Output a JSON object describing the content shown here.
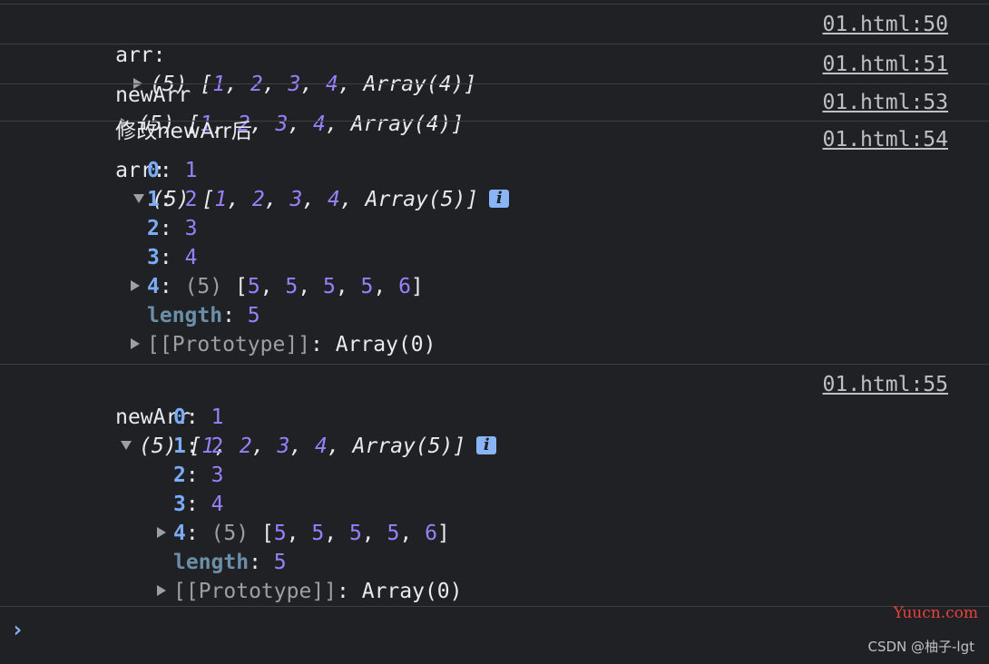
{
  "messages": [
    {
      "source": "01.html:50",
      "label": "arr:",
      "summary": {
        "count": "(5)",
        "open": "[",
        "v1": "1",
        "v2": "2",
        "v3": "3",
        "v4": "4",
        "tail": "Array(4)",
        "close": "]"
      }
    },
    {
      "source": "01.html:51",
      "label": "newArr",
      "summary": {
        "count": "(5)",
        "open": "[",
        "v1": "1",
        "v2": "2",
        "v3": "3",
        "v4": "4",
        "tail": "Array(4)",
        "close": "]"
      }
    },
    {
      "source": "01.html:53",
      "label": "修改newArr后"
    },
    {
      "source": "01.html:54",
      "label": "arr:",
      "summary": {
        "count": "(5)",
        "open": "[",
        "v1": "1",
        "v2": "2",
        "v3": "3",
        "v4": "4",
        "tail": "Array(5)",
        "close": "]"
      },
      "info_glyph": "i",
      "props": [
        {
          "key": "0",
          "value": "1"
        },
        {
          "key": "1",
          "value": "2"
        },
        {
          "key": "2",
          "value": "3"
        },
        {
          "key": "3",
          "value": "4"
        }
      ],
      "nested": {
        "key": "4",
        "count": "(5)",
        "values": [
          "5",
          "5",
          "5",
          "5",
          "6"
        ]
      },
      "length_key": "length",
      "length_value": "5",
      "prototype_key": "[[Prototype]]",
      "prototype_value": "Array(0)"
    },
    {
      "source": "01.html:55",
      "label": "newArr",
      "summary": {
        "count": "(5)",
        "open": "[",
        "v1": "1",
        "v2": "2",
        "v3": "3",
        "v4": "4",
        "tail": "Array(5)",
        "close": "]"
      },
      "info_glyph": "i",
      "props": [
        {
          "key": "0",
          "value": "1"
        },
        {
          "key": "1",
          "value": "2"
        },
        {
          "key": "2",
          "value": "3"
        },
        {
          "key": "3",
          "value": "4"
        }
      ],
      "nested": {
        "key": "4",
        "count": "(5)",
        "values": [
          "5",
          "5",
          "5",
          "5",
          "6"
        ]
      },
      "length_key": "length",
      "length_value": "5",
      "prototype_key": "[[Prototype]]",
      "prototype_value": "Array(0)"
    }
  ],
  "prompt": {
    "glyph": "›"
  },
  "watermarks": {
    "site": "Yuucn.com",
    "credit": "CSDN @柚子-lgt"
  },
  "colors": {
    "background": "#202124",
    "number": "#9980ff",
    "key": "#7cacf8",
    "accent": "#8ab4f8",
    "watermark": "#e8423b"
  }
}
